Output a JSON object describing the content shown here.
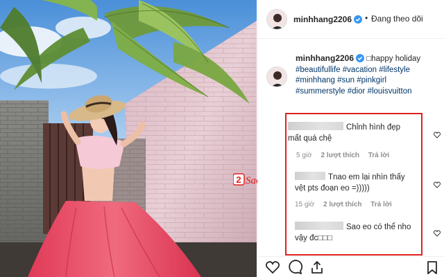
{
  "post": {
    "username": "minhhang2206",
    "follow_status": "Đang theo dõi",
    "caption": {
      "username": "minhhang2206",
      "text_intro": "□happy holiday",
      "hashtags": [
        "#beautifullife",
        "#vacation",
        "#lifestyle",
        "#minhhang",
        "#sun",
        "#pinkgirl",
        "#summerstyle",
        "#dior",
        "#louisvuitton"
      ]
    }
  },
  "comments": [
    {
      "text_line1": "Chỉnh hình đẹp",
      "text_line2": "mất quá chệ",
      "time": "5 giờ",
      "likes": "2 lượt thích",
      "reply": "Trả lời"
    },
    {
      "text_line1": "Tnao em lại nhìn thấy",
      "text_line2": "vệt pts đoạn eo =)))))",
      "time": "15 giờ",
      "likes": "2 lượt thích",
      "reply": "Trả lời"
    },
    {
      "text_line1": "Sao eo có thể nho",
      "text_line2": "vậy đc□□□"
    }
  ],
  "watermark": {
    "text_digit": "2",
    "text_word": "Sao"
  },
  "icons": [
    "verified-icon",
    "heart-icon",
    "comment-icon",
    "share-icon",
    "bookmark-icon"
  ],
  "colors": {
    "hashtag": "#003569",
    "verified": "#3897f0",
    "highlight_box": "#e02020",
    "skirt": "#e8405c"
  }
}
